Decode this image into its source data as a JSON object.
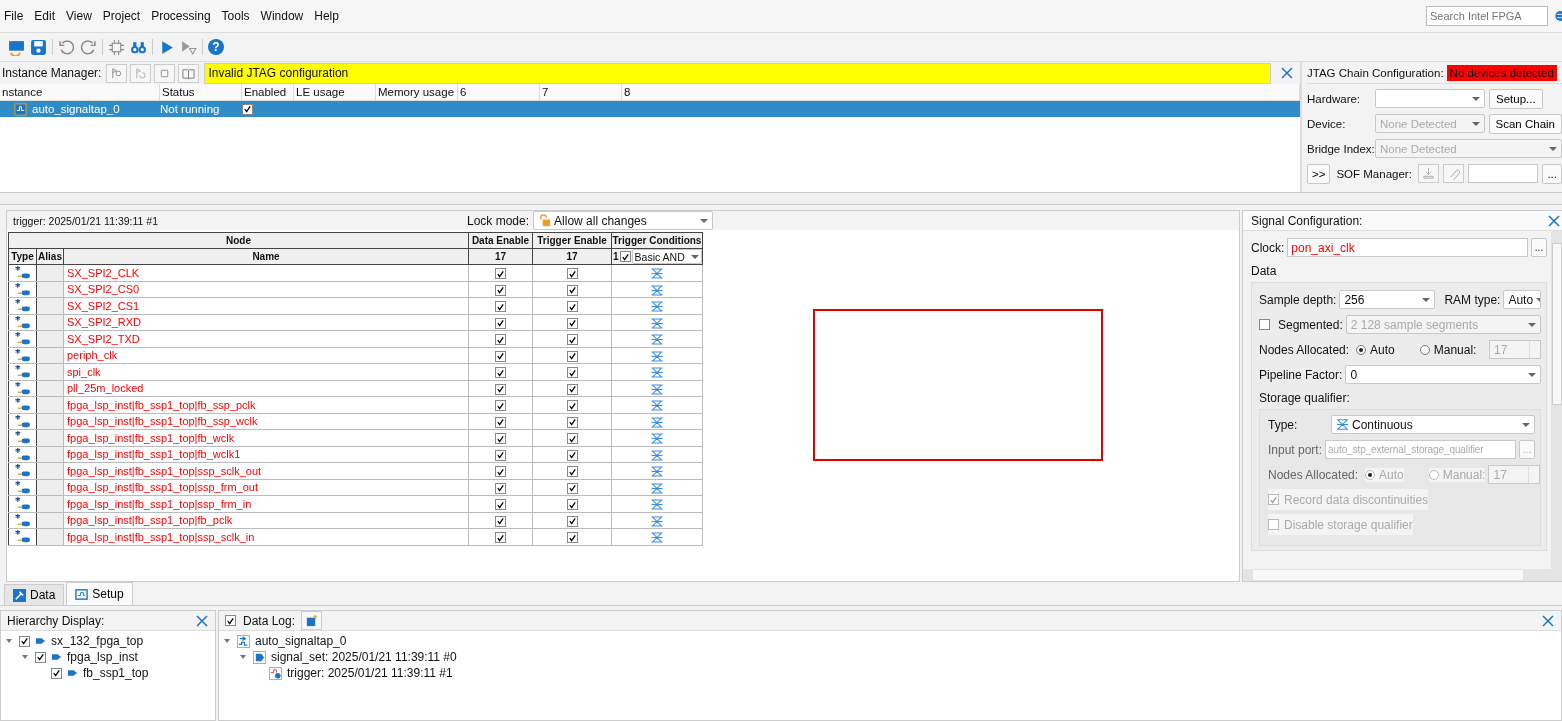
{
  "menu": [
    "File",
    "Edit",
    "View",
    "Project",
    "Processing",
    "Tools",
    "Window",
    "Help"
  ],
  "search": {
    "placeholder": "Search Intel FPGA"
  },
  "toolbar": {
    "help_glyph": "?"
  },
  "instance_manager": {
    "label": "Instance Manager:",
    "message": "Invalid JTAG configuration",
    "columns": [
      "nstance",
      "Status",
      "Enabled",
      "LE usage",
      "Memory usage",
      "6",
      "7",
      "8"
    ],
    "rows": [
      {
        "instance": "auto_signaltap_0",
        "status": "Not running",
        "enabled": true,
        "selected": true
      }
    ]
  },
  "jtag": {
    "title": "JTAG Chain Configuration:",
    "status": "No devices detected",
    "hardware_label": "Hardware:",
    "setup_button": "Setup...",
    "device_label": "Device:",
    "device_value": "None Detected",
    "scan_button": "Scan Chain",
    "bridge_label": "Bridge Index:",
    "bridge_value": "None Detected",
    "expand_button": ">>",
    "sof_label": "SOF Manager:",
    "browse_button": "..."
  },
  "setup": {
    "trigger_label": "trigger: 2025/01/21 11:39:11  #1",
    "lock_label": "Lock mode:",
    "lock_value": "Allow all changes",
    "group_headers": [
      "Node",
      "Data Enable",
      "Trigger Enable",
      "Trigger Conditions"
    ],
    "columns": [
      "Type",
      "Alias",
      "Name",
      "17",
      "17"
    ],
    "condition": {
      "index": "1",
      "checked": true,
      "value": "Basic AND"
    },
    "nodes": [
      {
        "name": "SX_SPI2_CLK",
        "data_enable": true,
        "trigger_enable": true
      },
      {
        "name": "SX_SPI2_CS0",
        "data_enable": true,
        "trigger_enable": true
      },
      {
        "name": "SX_SPI2_CS1",
        "data_enable": true,
        "trigger_enable": true
      },
      {
        "name": "SX_SPI2_RXD",
        "data_enable": true,
        "trigger_enable": true
      },
      {
        "name": "SX_SPI2_TXD",
        "data_enable": true,
        "trigger_enable": true
      },
      {
        "name": "periph_clk",
        "data_enable": true,
        "trigger_enable": true
      },
      {
        "name": "spi_clk",
        "data_enable": true,
        "trigger_enable": true
      },
      {
        "name": "pll_25m_locked",
        "data_enable": true,
        "trigger_enable": true
      },
      {
        "name": "fpga_lsp_inst|fb_ssp1_top|fb_ssp_pclk",
        "data_enable": true,
        "trigger_enable": true
      },
      {
        "name": "fpga_lsp_inst|fb_ssp1_top|fb_ssp_wclk",
        "data_enable": true,
        "trigger_enable": true
      },
      {
        "name": "fpga_lsp_inst|fb_ssp1_top|fb_wclk",
        "data_enable": true,
        "trigger_enable": true
      },
      {
        "name": "fpga_lsp_inst|fb_ssp1_top|fb_wclk1",
        "data_enable": true,
        "trigger_enable": true
      },
      {
        "name": "fpga_lsp_inst|fb_ssp1_top|ssp_sclk_out",
        "data_enable": true,
        "trigger_enable": true
      },
      {
        "name": "fpga_lsp_inst|fb_ssp1_top|ssp_frm_out",
        "data_enable": true,
        "trigger_enable": true
      },
      {
        "name": "fpga_lsp_inst|fb_ssp1_top|ssp_frm_in",
        "data_enable": true,
        "trigger_enable": true
      },
      {
        "name": "fpga_lsp_inst|fb_ssp1_top|fb_pclk",
        "data_enable": true,
        "trigger_enable": true
      },
      {
        "name": "fpga_lsp_inst|fb_ssp1_top|ssp_sclk_in",
        "data_enable": true,
        "trigger_enable": true
      }
    ]
  },
  "signal_config": {
    "title": "Signal Configuration:",
    "clock_label": "Clock:",
    "clock_value": "pon_axi_clk",
    "browse_button": "...",
    "data_title": "Data",
    "sample_depth_label": "Sample depth:",
    "sample_depth": "256",
    "ram_type_label": "RAM type:",
    "ram_type": "Auto",
    "segmented": {
      "label": "Segmented:",
      "checked": false,
      "value": "2  128 sample segments"
    },
    "nodes_allocated": {
      "label": "Nodes Allocated:",
      "options": [
        {
          "label": "Auto",
          "selected": true
        },
        {
          "label": "Manual:",
          "selected": false
        }
      ],
      "value": "17"
    },
    "pipeline_label": "Pipeline Factor:",
    "pipeline": "0",
    "storage_title": "Storage qualifier:",
    "type_label": "Type:",
    "type_value": "Continuous",
    "input_port_label": "Input port:",
    "input_port_value": "auto_stp_external_storage_qualifier",
    "input_port_button": "...",
    "sq_nodes_allocated": {
      "label": "Nodes Allocated:",
      "options": [
        {
          "label": "Auto",
          "selected": true
        },
        {
          "label": "Manual:",
          "selected": false
        }
      ],
      "value": "17"
    },
    "record": {
      "label": "Record data discontinuities",
      "checked": true
    },
    "disable": {
      "label": "Disable storage qualifier",
      "checked": false
    }
  },
  "view_tabs": [
    {
      "label": "Data",
      "selected": false
    },
    {
      "label": "Setup",
      "selected": true
    }
  ],
  "hierarchy": {
    "title": "Hierarchy Display:",
    "tree": [
      {
        "label": "sx_132_fpga_top",
        "checked": true,
        "expanded": true,
        "children": [
          {
            "label": "fpga_lsp_inst",
            "checked": true,
            "expanded": true,
            "children": [
              {
                "label": "fb_ssp1_top",
                "checked": true
              }
            ]
          }
        ]
      }
    ]
  },
  "data_log": {
    "title": "Data Log:",
    "checked": true,
    "tree": [
      {
        "label": "auto_signaltap_0",
        "kind": "instance",
        "expanded": true,
        "children": [
          {
            "label": "signal_set: 2025/01/21 11:39:11  #0",
            "kind": "signal_set",
            "expanded": true,
            "children": [
              {
                "label": "trigger: 2025/01/21 11:39:11  #1",
                "kind": "trigger"
              }
            ]
          }
        ]
      }
    ]
  }
}
